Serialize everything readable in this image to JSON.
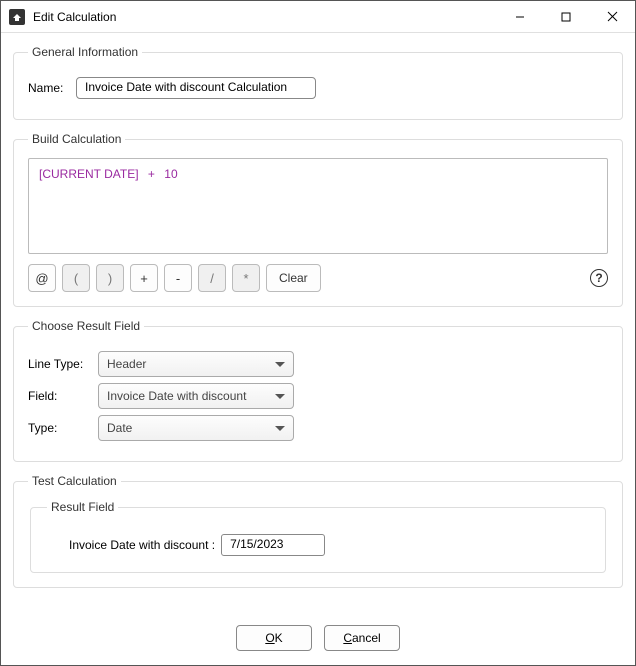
{
  "window": {
    "title": "Edit Calculation"
  },
  "general": {
    "legend": "General Information",
    "name_label": "Name:",
    "name_value": "Invoice Date with discount  Calculation"
  },
  "build": {
    "legend": "Build Calculation",
    "expr_var": "[CURRENT DATE]",
    "expr_op": "+",
    "expr_num": "10",
    "btn_at": "@",
    "btn_lp": "(",
    "btn_rp": ")",
    "btn_plus": "+",
    "btn_minus": "-",
    "btn_div": "/",
    "btn_mul": "*",
    "btn_clear": "Clear",
    "help": "?"
  },
  "result": {
    "legend": "Choose Result Field",
    "linetype_label": "Line Type:",
    "linetype_value": "Header",
    "field_label": "Field:",
    "field_value": "Invoice Date with discount",
    "type_label": "Type:",
    "type_value": "Date"
  },
  "test": {
    "legend": "Test Calculation",
    "inner_legend": "Result Field",
    "field_label": "Invoice Date with discount :",
    "field_value": "7/15/2023"
  },
  "footer": {
    "ok_u": "O",
    "ok_r": "K",
    "cancel_u": "C",
    "cancel_r": "ancel"
  }
}
